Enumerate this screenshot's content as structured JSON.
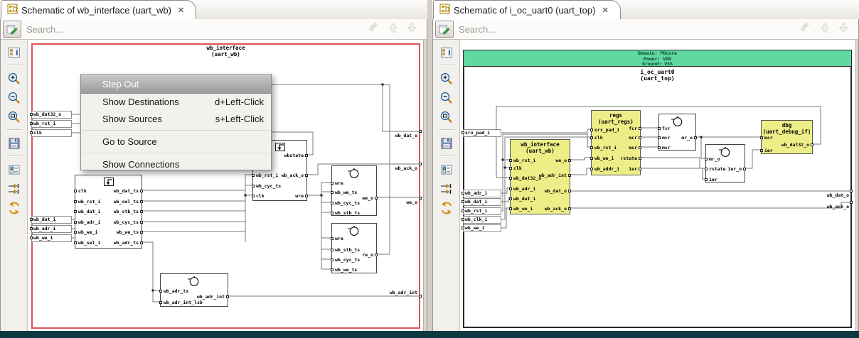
{
  "icons": {
    "tab": "schematic-icon",
    "close_glyph": "✕",
    "side_toolbar": [
      "properties-icon",
      "zoom-in-icon",
      "zoom-out-icon",
      "zoom-selection-icon",
      "save-icon",
      "filter-options-icon",
      "trace-arrows-icon",
      "reload-icon"
    ],
    "search_toolbar": [
      "edit-search-icon",
      "clear-highlight-icon",
      "arrow-up-icon",
      "arrow-down-icon"
    ],
    "block_icons": [
      "flipflop-icon",
      "logic-icon"
    ]
  },
  "colors": {
    "boundary_left": "#e05252",
    "boundary_right": "#2a2a2a",
    "module_fill": "#eeee88",
    "banner_fill": "#5fd8a2",
    "banner_text": "#073f24",
    "menu_highlight": "#a8a8a8",
    "bottom_bar": "#0d3a41"
  },
  "panes": [
    {
      "tab": {
        "title": "Schematic of wb_interface (uart_wb)"
      },
      "search": {
        "placeholder": "Search..."
      },
      "schematic": {
        "title": "wb_interface",
        "subtitle": "(uart_wb)",
        "left_ports": [
          "wb_dat32_o",
          "wb_rst_i",
          "clk",
          "wb_dat_i",
          "wb_adr_i",
          "wb_we_i"
        ],
        "right_ports": [
          "wb_dat_o",
          "wb_ack_o",
          "we_o",
          "wb_adr_int"
        ],
        "blocks": [
          {
            "name": "reg-block",
            "left": [
              "clk",
              "wb_rst_i",
              "wb_dat_i",
              "wb_adr_i",
              "wb_we_i",
              "wb_sel_i"
            ],
            "right": [
              "wb_dat_ts",
              "wb_sel_ts",
              "wb_stb_ts",
              "wb_cyc_ts",
              "wb_we_ts",
              "wb_adr_ts"
            ]
          },
          {
            "name": "state-block",
            "left": [
              "wb_rst_i",
              "wb_cyc_ts",
              "clk"
            ],
            "right": [
              "wbstate",
              "wb_ack_o",
              "wre"
            ]
          },
          {
            "name": "we-gate",
            "left": [
              "wre",
              "wb_we_ts",
              "wb_cyc_ts",
              "wb_stb_ts"
            ],
            "right": [
              "we_o"
            ]
          },
          {
            "name": "re-gate",
            "left": [
              "wre",
              "wb_stb_ts",
              "wb_cyc_ts",
              "wb_we_ts"
            ],
            "right": [
              "re_o"
            ]
          },
          {
            "name": "adr-gate",
            "left": [
              "wb_adr_ts",
              "wb_adr_int_lsb"
            ],
            "right": [
              "wb_adr_int"
            ]
          }
        ]
      },
      "context_menu": {
        "items": [
          {
            "label": "Step Out",
            "shortcut": ""
          },
          {
            "label": "Show Destinations",
            "shortcut": "d+Left-Click"
          },
          {
            "label": "Show Sources",
            "shortcut": "s+Left-Click"
          },
          {
            "label": "Go to Source",
            "shortcut": ""
          },
          {
            "label": "Show Connections",
            "shortcut": ""
          }
        ]
      }
    },
    {
      "tab": {
        "title": "Schematic of i_oc_uart0 (uart_top)"
      },
      "search": {
        "placeholder": "Search..."
      },
      "schematic": {
        "banner": {
          "lines": [
            "Domain: PDcore",
            "Power: VDD",
            "Ground: VSS"
          ]
        },
        "title": "i_oc_uart0",
        "subtitle": "(uart_top)",
        "left_ports": [
          "srx_pad_i",
          "wb_adr_i",
          "wb_dat_i",
          "wb_rst_i",
          "wb_clk_i",
          "wb_we_i"
        ],
        "right_ports": [
          "wb_dat_o",
          "wb_ack_o"
        ],
        "blocks": [
          {
            "name": "wb-interface-block",
            "title": "wb_interface",
            "subtitle": "(uart_wb)",
            "left": [
              "wb_rst_i",
              "clk",
              "wb_dat32_o",
              "wb_adr_i",
              "wb_dat_i",
              "wb_we_i"
            ],
            "right": [
              "we_o",
              "wb_adr_int",
              "wb_dat_o",
              "wb_ack_o"
            ]
          },
          {
            "name": "regs-block",
            "title": "regs",
            "subtitle": "(uart_regs)",
            "left": [
              "srx_pad_i",
              "clk",
              "wb_rst_i",
              "wb_we_i",
              "wb_addr_i"
            ],
            "right": [
              "fcr",
              "mcr",
              "msr",
              "rstate",
              "ier"
            ]
          },
          {
            "name": "mr-gate",
            "left": [
              "fcr",
              "mcr",
              "msr"
            ],
            "right": [
              "mr_o"
            ]
          },
          {
            "name": "ier-gate",
            "left": [
              "mr_o",
              "rstate",
              "ier"
            ],
            "right": [
              "ier_o"
            ]
          },
          {
            "name": "dbg-block",
            "title": "dbg",
            "subtitle": "(uart_debug_if)",
            "left": [
              "mcr",
              "ier"
            ],
            "right": [
              "wb_dat32_o"
            ]
          }
        ]
      }
    }
  ]
}
